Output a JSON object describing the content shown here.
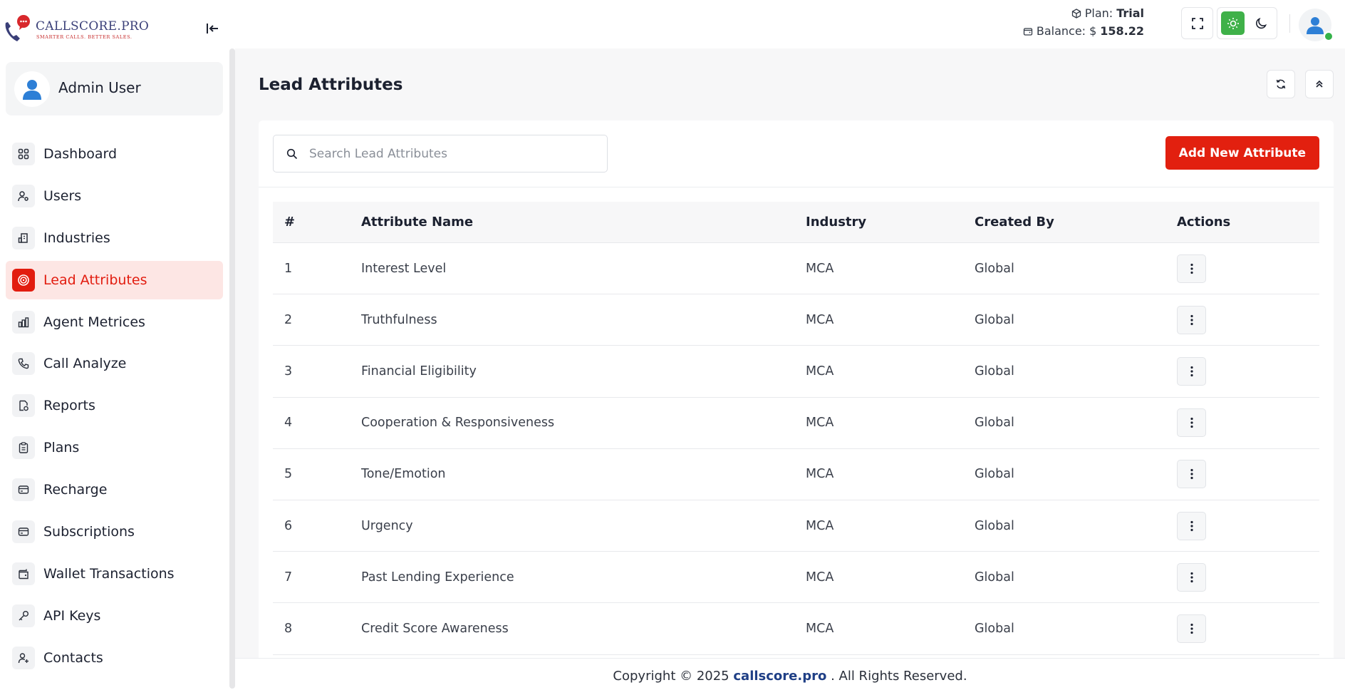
{
  "brand": {
    "name": "CALLSCORE.PRO",
    "tagline": "SMARTER CALLS. BETTER SALES."
  },
  "user": {
    "name": "Admin User"
  },
  "sidebar": {
    "items": [
      {
        "label": "Dashboard",
        "icon": "grid-icon"
      },
      {
        "label": "Users",
        "icon": "user-gear-icon"
      },
      {
        "label": "Industries",
        "icon": "building-icon"
      },
      {
        "label": "Lead Attributes",
        "icon": "target-icon",
        "active": true
      },
      {
        "label": "Agent Metrices",
        "icon": "bar-chart-icon"
      },
      {
        "label": "Call Analyze",
        "icon": "phone-icon"
      },
      {
        "label": "Reports",
        "icon": "report-icon"
      },
      {
        "label": "Plans",
        "icon": "clipboard-icon"
      },
      {
        "label": "Recharge",
        "icon": "card-icon"
      },
      {
        "label": "Subscriptions",
        "icon": "card-icon"
      },
      {
        "label": "Wallet Transactions",
        "icon": "wallet-icon"
      },
      {
        "label": "API Keys",
        "icon": "key-icon"
      },
      {
        "label": "Contacts",
        "icon": "user-plus-icon"
      }
    ]
  },
  "topbar": {
    "plan_label": "Plan:",
    "plan_value": "Trial",
    "balance_label": "Balance:",
    "balance_currency": "$",
    "balance_value": "158.22"
  },
  "page": {
    "title": "Lead Attributes",
    "search_placeholder": "Search Lead Attributes",
    "add_button": "Add New Attribute"
  },
  "table": {
    "columns": [
      "#",
      "Attribute Name",
      "Industry",
      "Created By",
      "Actions"
    ],
    "rows": [
      {
        "num": "1",
        "name": "Interest Level",
        "industry": "MCA",
        "created_by": "Global"
      },
      {
        "num": "2",
        "name": "Truthfulness",
        "industry": "MCA",
        "created_by": "Global"
      },
      {
        "num": "3",
        "name": "Financial Eligibility",
        "industry": "MCA",
        "created_by": "Global"
      },
      {
        "num": "4",
        "name": "Cooperation & Responsiveness",
        "industry": "MCA",
        "created_by": "Global"
      },
      {
        "num": "5",
        "name": "Tone/Emotion",
        "industry": "MCA",
        "created_by": "Global"
      },
      {
        "num": "6",
        "name": "Urgency",
        "industry": "MCA",
        "created_by": "Global"
      },
      {
        "num": "7",
        "name": "Past Lending Experience",
        "industry": "MCA",
        "created_by": "Global"
      },
      {
        "num": "8",
        "name": "Credit Score Awareness",
        "industry": "MCA",
        "created_by": "Global"
      }
    ]
  },
  "footer": {
    "prefix": "Copyright © 2025",
    "brand": "callscore.pro",
    "suffix": ". All Rights Reserved."
  },
  "colors": {
    "accent": "#e21c0f",
    "active_bg": "#fde6e4",
    "theme_light_active": "#3fb149",
    "footer_brand": "#1f3f86"
  }
}
